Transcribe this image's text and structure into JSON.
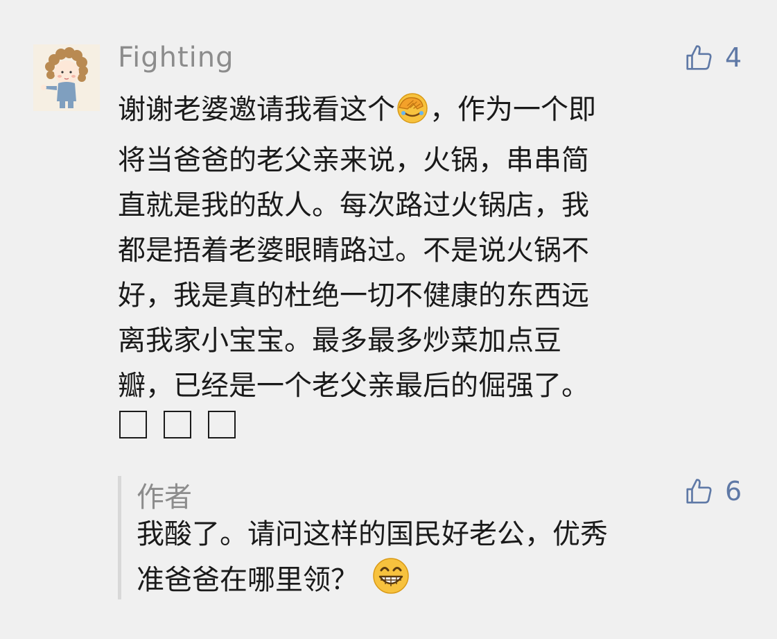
{
  "comment": {
    "username": "Fighting",
    "like_count": "4",
    "text_part1": "谢谢老婆邀请我看这个",
    "text_part1_after": "，作为一个即",
    "lines": [
      "将当爸爸的老父亲来说，火锅，串串简",
      "直就是我的敌人。每次路过火锅店，我",
      "都是捂着老婆眼睛路过。不是说火锅不",
      "好，我是真的杜绝一切不健康的东西远",
      "离我家小宝宝。最多最多炒菜加点豆",
      "瓣，已经是一个老父亲最后的倔强了。"
    ],
    "emoji_1": "face-palm-emoji",
    "unsupported_glyph_count": 3
  },
  "reply": {
    "author": "作者",
    "like_count": "6",
    "line1": "我酸了。请问这样的国民好老公，优秀",
    "line2": "准爸爸在哪里领？",
    "emoji_2": "grinning-face-emoji"
  },
  "colors": {
    "background": "#f0f0f0",
    "text": "#1a1a1a",
    "muted": "#8c8c8c",
    "accent": "#5f79a6",
    "reply_bar": "#d8d8d8"
  }
}
